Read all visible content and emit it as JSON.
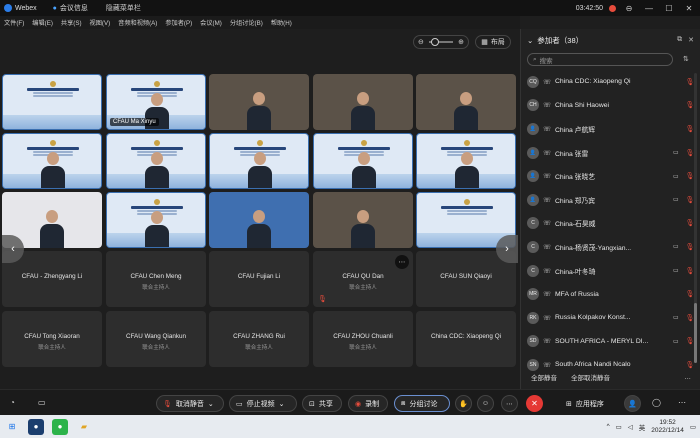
{
  "titlebar": {
    "app_name": "Webex",
    "meeting_info": "会议信息",
    "hide_menu": "隐藏菜单栏",
    "clock": "03:42:50"
  },
  "menu": [
    "文件(F)",
    "编辑(E)",
    "共享(S)",
    "视图(V)",
    "音频和视频(A)",
    "参加者(P)",
    "会议(M)",
    "分组讨论(B)",
    "帮助(H)"
  ],
  "toolbar": {
    "layout_label": "布局"
  },
  "tiles": [
    {
      "type": "banner",
      "name": ""
    },
    {
      "type": "person",
      "name": "CFAU Ma Xinyu"
    },
    {
      "type": "room",
      "name": ""
    },
    {
      "type": "room",
      "name": ""
    },
    {
      "type": "room",
      "name": ""
    },
    {
      "type": "banner-person",
      "name": ""
    },
    {
      "type": "banner-person",
      "name": ""
    },
    {
      "type": "banner-person",
      "name": ""
    },
    {
      "type": "banner-person",
      "name": ""
    },
    {
      "type": "banner-person",
      "name": ""
    },
    {
      "type": "person-dark",
      "name": ""
    },
    {
      "type": "banner-person",
      "name": ""
    },
    {
      "type": "room-blue",
      "name": ""
    },
    {
      "type": "room",
      "name": ""
    },
    {
      "type": "banner-empty",
      "name": ""
    }
  ],
  "empty_tiles": [
    {
      "name": "CFAU - Zhengyang Li",
      "sub": "",
      "muted": false,
      "more": false
    },
    {
      "name": "CFAU Chen Meng",
      "sub": "联合主持人",
      "muted": false,
      "more": false
    },
    {
      "name": "CFAU Fujian Li",
      "sub": "",
      "muted": false,
      "more": false
    },
    {
      "name": "CFAU QU Dan",
      "sub": "联合主持人",
      "muted": true,
      "more": true
    },
    {
      "name": "CFAU SUN Qiaoyi",
      "sub": "",
      "muted": false,
      "more": false
    },
    {
      "name": "CFAU Tong Xiaoran",
      "sub": "联合主持人",
      "muted": false,
      "more": false
    },
    {
      "name": "CFAU Wang Qiankun",
      "sub": "联合主持人",
      "muted": false,
      "more": false
    },
    {
      "name": "CFAU ZHANG Rui",
      "sub": "联合主持人",
      "muted": false,
      "more": false
    },
    {
      "name": "CFAU ZHOU Chuanli",
      "sub": "联合主持人",
      "muted": false,
      "more": false
    },
    {
      "name": "China CDC: Xiaopeng Qi",
      "sub": "",
      "muted": false,
      "more": false
    }
  ],
  "panel": {
    "title": "参加者（38）",
    "search_placeholder": "搜索",
    "mute_all": "全部静音",
    "unmute_all": "全部取消静音",
    "participants": [
      {
        "avatar": "CQ",
        "name": "China CDC: Xiaopeng Qi",
        "cam": false
      },
      {
        "avatar": "CH",
        "name": "China Shi Haowei",
        "cam": false
      },
      {
        "avatar": "👤",
        "name": "China 卢航辉",
        "cam": false
      },
      {
        "avatar": "👤",
        "name": "China 张雷",
        "cam": true
      },
      {
        "avatar": "👤",
        "name": "China 张晓艺",
        "cam": true
      },
      {
        "avatar": "👤",
        "name": "China 郑乃宾",
        "cam": true
      },
      {
        "avatar": "C",
        "name": "China-石昊威",
        "cam": false
      },
      {
        "avatar": "C",
        "name": "China-杨贤茂-Yangxian...",
        "cam": true
      },
      {
        "avatar": "C",
        "name": "China-叶冬琦",
        "cam": true
      },
      {
        "avatar": "MR",
        "name": "MFA of Russia",
        "cam": false
      },
      {
        "avatar": "RK",
        "name": "Russia Kolpakov Konst...",
        "cam": true
      },
      {
        "avatar": "SD",
        "name": "SOUTH AFRICA - MERYL DI...",
        "cam": true
      },
      {
        "avatar": "SN",
        "name": "South Africa Nandi Ncalo",
        "cam": false
      }
    ]
  },
  "controls": {
    "unmute": "取消静音",
    "stop_video": "停止视频",
    "share": "共享",
    "record": "录制",
    "breakout": "分组讨论",
    "apps": "应用程序"
  },
  "taskbar": {
    "ime": "英",
    "time": "19:52",
    "date": "2022/12/14"
  }
}
